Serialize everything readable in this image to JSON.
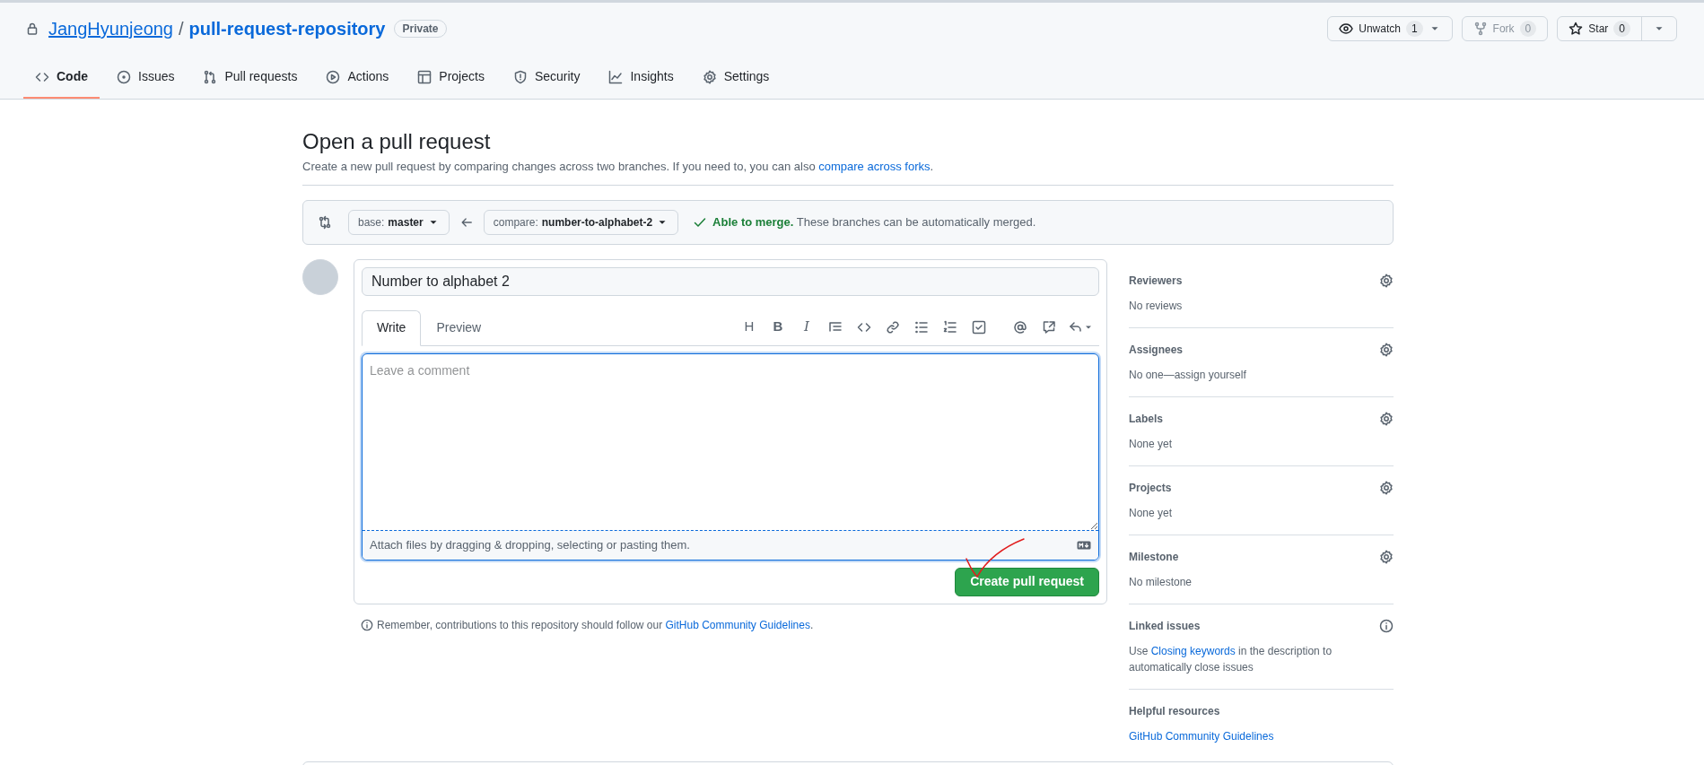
{
  "repo": {
    "owner": "JangHyunjeong",
    "separator": "/",
    "name": "pull-request-repository",
    "visibility": "Private"
  },
  "repo_actions": [
    {
      "kind": "watch",
      "label": "Unwatch",
      "count": "1",
      "disabled": false,
      "menu": true
    },
    {
      "kind": "fork",
      "label": "Fork",
      "count": "0",
      "disabled": true,
      "menu": false
    },
    {
      "kind": "star",
      "label": "Star",
      "count": "0",
      "disabled": false,
      "menu": true
    }
  ],
  "tabs": [
    {
      "kind": "code",
      "label": "Code",
      "selected": true
    },
    {
      "kind": "issues",
      "label": "Issues",
      "selected": false
    },
    {
      "kind": "pulls",
      "label": "Pull requests",
      "selected": false
    },
    {
      "kind": "actions",
      "label": "Actions",
      "selected": false
    },
    {
      "kind": "projects",
      "label": "Projects",
      "selected": false
    },
    {
      "kind": "security",
      "label": "Security",
      "selected": false
    },
    {
      "kind": "insights",
      "label": "Insights",
      "selected": false
    },
    {
      "kind": "settings",
      "label": "Settings",
      "selected": false
    }
  ],
  "page": {
    "title": "Open a pull request",
    "description": {
      "before": "Create a new pull request by comparing changes across two branches. If you need to, you can also ",
      "link": "compare across forks",
      "after": "."
    }
  },
  "compare": {
    "base_prefix": "base:",
    "base": "master",
    "compare_prefix": "compare:",
    "compare": "number-to-alphabet-2",
    "status": "Able to merge.",
    "status_text": "These branches can be automatically merged."
  },
  "pr_form": {
    "title_value": "Number to alphabet 2",
    "editor_tabs": [
      {
        "label": "Write",
        "selected": true
      },
      {
        "label": "Preview",
        "selected": false
      }
    ],
    "toolbar": [
      {
        "kind": "heading",
        "label": "H"
      },
      {
        "kind": "bold",
        "label": "B"
      },
      {
        "kind": "italic",
        "label": "I"
      },
      {
        "kind": "quote"
      },
      {
        "kind": "code"
      },
      {
        "kind": "link"
      },
      {
        "kind": "bullets"
      },
      {
        "kind": "numbers"
      },
      {
        "kind": "tasks"
      },
      {
        "kind": "gap"
      },
      {
        "kind": "mention"
      },
      {
        "kind": "reference"
      },
      {
        "kind": "reply"
      }
    ],
    "comment_placeholder": "Leave a comment",
    "attach_hint": "Attach files by dragging & dropping, selecting or pasting them.",
    "submit": "Create pull request"
  },
  "guidelines_note": {
    "before": "Remember, contributions to this repository should follow our ",
    "link": "GitHub Community Guidelines",
    "after": "."
  },
  "sidebar": [
    {
      "kind": "gear",
      "title": "Reviewers",
      "value": "No reviews"
    },
    {
      "kind": "gear",
      "title": "Assignees",
      "value": "No one—assign yourself"
    },
    {
      "kind": "gear",
      "title": "Labels",
      "value": "None yet"
    },
    {
      "kind": "gear",
      "title": "Projects",
      "value": "None yet"
    },
    {
      "kind": "gear",
      "title": "Milestone",
      "value": "No milestone"
    },
    {
      "kind": "info",
      "title": "Linked issues",
      "text": {
        "before": "Use ",
        "link": "Closing keywords",
        "after": " in the description to automatically close issues"
      }
    },
    {
      "kind": "links",
      "title": "Helpful resources",
      "links": [
        "GitHub Community Guidelines"
      ]
    }
  ]
}
